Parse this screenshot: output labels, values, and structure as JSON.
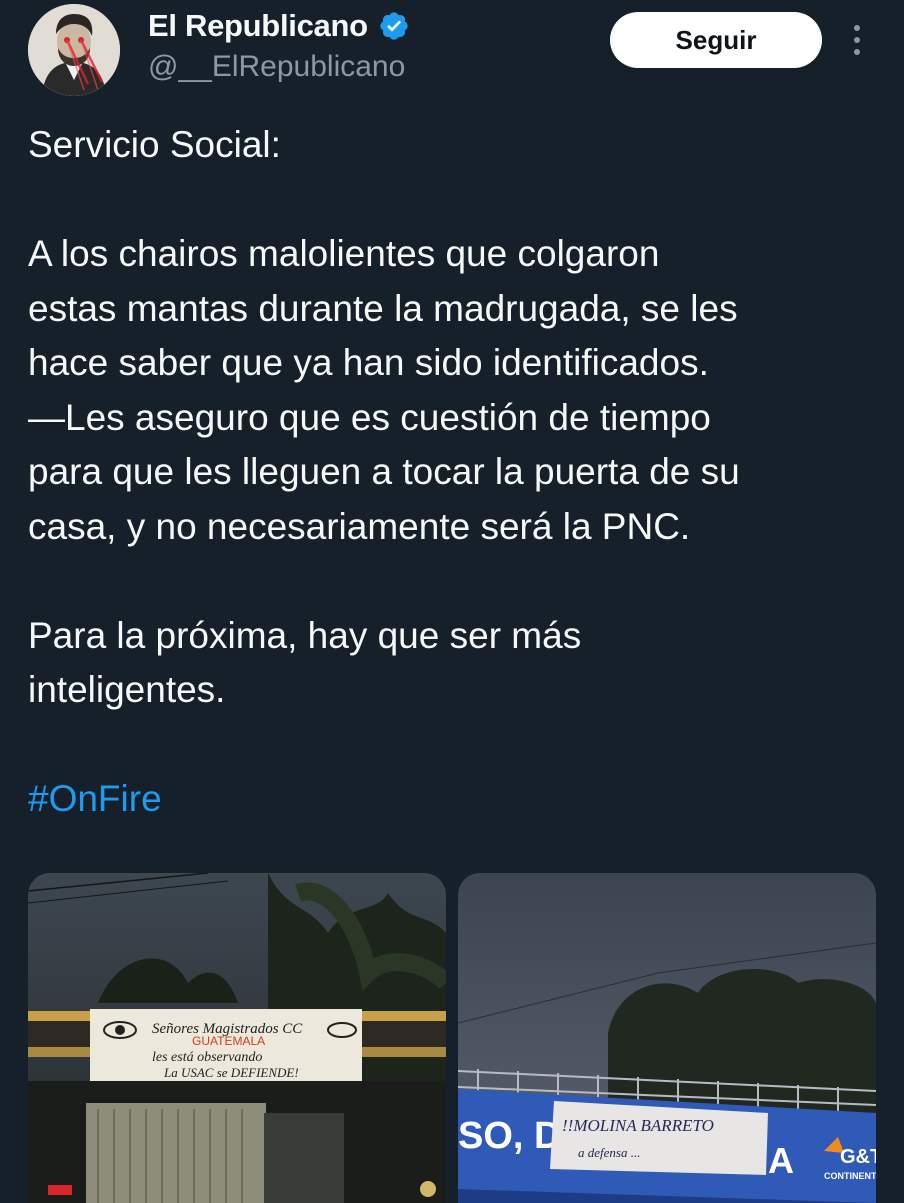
{
  "author": {
    "display_name": "El Republicano",
    "handle": "@__ElRepublicano",
    "verified": true,
    "verified_color": "#1d9bf0"
  },
  "follow_button": {
    "label": "Seguir"
  },
  "tweet": {
    "lines": [
      "Servicio Social:",
      "",
      "A los chairos malolientes que colgaron",
      "estas mantas durante la madrugada, se les",
      "hace saber que ya han sido identificados.",
      "—Les aseguro que es cuestión de tiempo",
      "para que les lleguen a tocar la puerta de su",
      "casa, y no necesariamente será la PNC.",
      "",
      "Para la próxima, hay que ser más",
      "inteligentes."
    ],
    "hashtag": "#OnFire"
  },
  "media": {
    "photo1": {
      "banner_lines": [
        "Señores Magistrados CC",
        "GUATEMALA",
        "les está observando",
        "La USAC se DEFIENDE!"
      ]
    },
    "photo2": {
      "sign_text": "SO, D",
      "sign_text_end": "A",
      "brand": "G&T",
      "brand_sub": "CONTINENTAL",
      "banner_text": "!!MOLINA BARRETO",
      "banner_sub": "a defensa ..."
    }
  },
  "colors": {
    "background": "#15202b",
    "text": "#f7f9f9",
    "secondary": "#8b98a5",
    "link": "#1d9bf0"
  }
}
